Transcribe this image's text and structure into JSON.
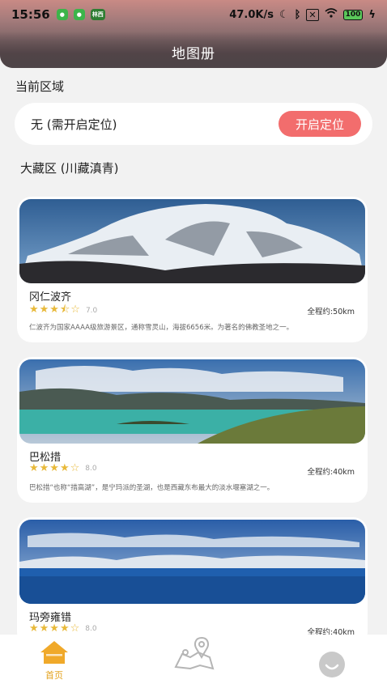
{
  "status_bar": {
    "time": "15:56",
    "app_badge": "林西",
    "network_speed": "47.0K/s",
    "battery": "100"
  },
  "header": {
    "title": "地图册"
  },
  "current_area": {
    "section_label": "当前区域",
    "location_text": "无 (需开启定位)",
    "enable_button_label": "开启定位"
  },
  "region": {
    "label": "大藏区 (川藏滇青)"
  },
  "spots": [
    {
      "name": "冈仁波齐",
      "stars": "★★★⯪☆",
      "rating": "7.0",
      "distance": "全程约:50km",
      "description": "仁波齐为国家AAAA级旅游景区，通称雪灵山，海拔6656米。为著名的佛教圣地之一。"
    },
    {
      "name": "巴松措",
      "stars": "★★★★☆",
      "rating": "8.0",
      "distance": "全程约:40km",
      "description": "巴松措“也称“措高湖”，是宁玛派的圣湖，也是西藏东布最大的淡水堰塞湖之一。"
    },
    {
      "name": "玛旁雍错",
      "stars": "★★★★☆",
      "rating": "8.0",
      "distance": "全程约:40km",
      "description": ""
    }
  ],
  "tabbar": {
    "home_label": "首页",
    "home_icon": "home-icon",
    "map_icon": "map-pin-icon",
    "me_icon": "smile-face-icon",
    "active_color": "#e3a21e"
  },
  "colors": {
    "accent": "#f26d6d",
    "star": "#e8b93a"
  }
}
